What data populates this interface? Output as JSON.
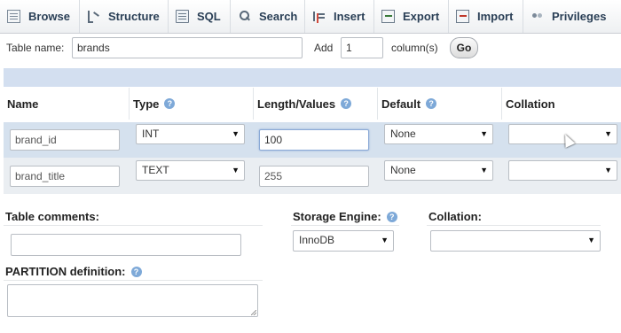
{
  "tabs": [
    {
      "label": "Browse",
      "icon": "browse-icon"
    },
    {
      "label": "Structure",
      "icon": "structure-icon"
    },
    {
      "label": "SQL",
      "icon": "sql-icon"
    },
    {
      "label": "Search",
      "icon": "search-icon"
    },
    {
      "label": "Insert",
      "icon": "insert-icon"
    },
    {
      "label": "Export",
      "icon": "export-icon"
    },
    {
      "label": "Import",
      "icon": "import-icon"
    },
    {
      "label": "Privileges",
      "icon": "privileges-icon"
    }
  ],
  "top_form": {
    "table_name_label": "Table name:",
    "table_name_value": "brands",
    "add_label": "Add",
    "add_value": "1",
    "columns_label": "column(s)",
    "go_label": "Go"
  },
  "columns_header": {
    "name": "Name",
    "type": "Type",
    "length": "Length/Values",
    "default": "Default",
    "collation": "Collation",
    "help_glyph": "?"
  },
  "rows": [
    {
      "name": "brand_id",
      "type": "INT",
      "length": "100",
      "default": "None",
      "collation": ""
    },
    {
      "name": "brand_title",
      "type": "TEXT",
      "length": "255",
      "default": "None",
      "collation": ""
    }
  ],
  "bottom": {
    "table_comments_label": "Table comments:",
    "table_comments_value": "",
    "storage_engine_label": "Storage Engine:",
    "storage_engine_value": "InnoDB",
    "collation_label": "Collation:",
    "collation_value": "",
    "partition_label": "PARTITION definition:",
    "partition_value": ""
  },
  "colors": {
    "tab_text": "#2a3f56",
    "header_bar": "#d3dff0",
    "row_highlight": "#d5e1ee",
    "row_alt": "#eaeef2",
    "help_icon": "#7ea9d8"
  }
}
